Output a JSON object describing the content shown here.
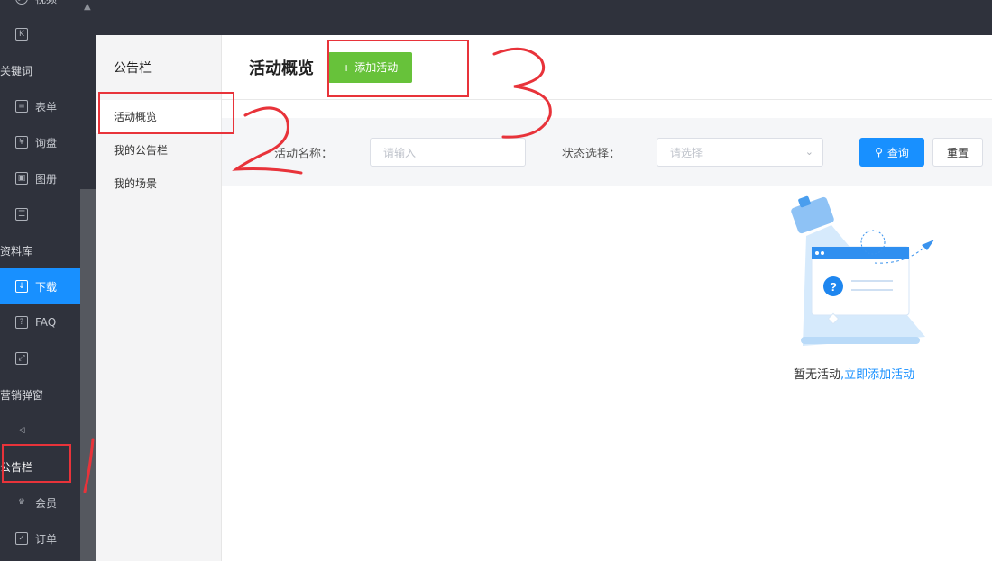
{
  "nav": {
    "items": [
      {
        "label": "视频",
        "icon": "video-icon",
        "kind": "sub"
      },
      {
        "label": "",
        "icon": "k-icon",
        "kind": "sub"
      },
      {
        "label": "关键词",
        "icon": "",
        "kind": "group"
      },
      {
        "label": "表单",
        "icon": "form-icon",
        "kind": "sub"
      },
      {
        "label": "询盘",
        "icon": "inquiry-icon",
        "kind": "sub"
      },
      {
        "label": "图册",
        "icon": "album-icon",
        "kind": "sub"
      },
      {
        "label": "",
        "icon": "server-icon",
        "kind": "sub"
      },
      {
        "label": "资料库",
        "icon": "",
        "kind": "group"
      },
      {
        "label": "下载",
        "icon": "download-icon",
        "kind": "sub",
        "active": true
      },
      {
        "label": "FAQ",
        "icon": "faq-icon",
        "kind": "sub"
      },
      {
        "label": "",
        "icon": "expand-icon",
        "kind": "sub"
      },
      {
        "label": "营销弹窗",
        "icon": "",
        "kind": "group"
      },
      {
        "label": "",
        "icon": "speaker-icon",
        "kind": "sub"
      },
      {
        "label": "公告栏",
        "icon": "",
        "kind": "group",
        "highlight": true
      },
      {
        "label": "会员",
        "icon": "crown-icon",
        "kind": "sub"
      },
      {
        "label": "订单",
        "icon": "order-icon",
        "kind": "sub"
      }
    ]
  },
  "subnav": {
    "title": "公告栏",
    "items": [
      {
        "label": "活动概览",
        "active": true
      },
      {
        "label": "我的公告栏"
      },
      {
        "label": "我的场景"
      }
    ]
  },
  "main": {
    "title": "活动概览",
    "add_button": "添加活动",
    "filter": {
      "name_label": "活动名称：",
      "name_placeholder": "请输入",
      "status_label": "状态选择：",
      "status_placeholder": "请选择",
      "query_button": "查询",
      "reset_button": "重置"
    },
    "empty": {
      "text": "暂无活动",
      "link": ",立即添加活动"
    }
  },
  "annotations": [
    "1",
    "2",
    "3"
  ],
  "colors": {
    "nav_bg": "#2f323c",
    "accent": "#1890ff",
    "add_green": "#67c23a",
    "annotation_red": "#e8333a"
  }
}
